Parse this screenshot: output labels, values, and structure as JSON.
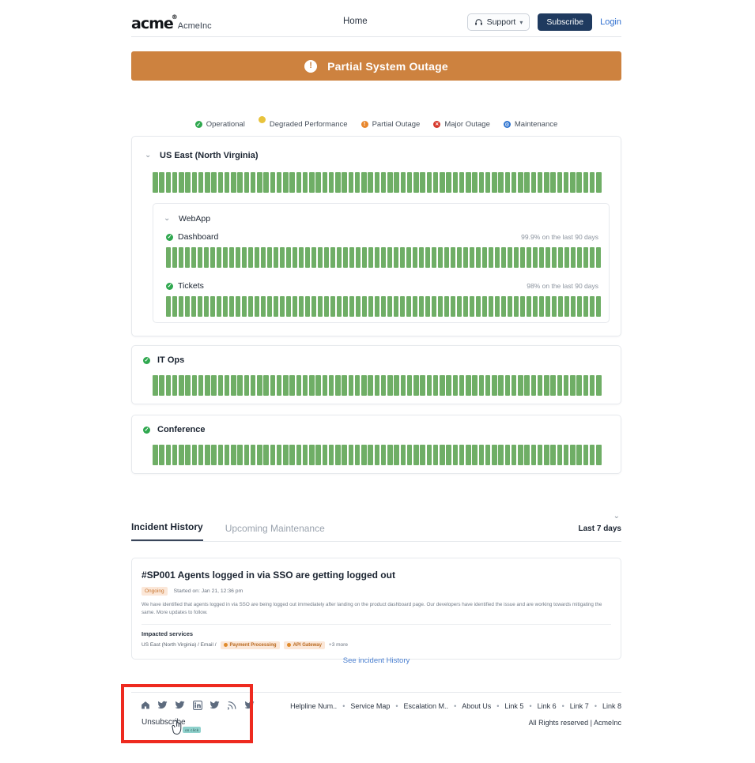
{
  "header": {
    "logo_text": "acme",
    "logo_tm": "®",
    "brand_name": "AcmeInc",
    "nav_home": "Home",
    "support_label": "Support",
    "support_icon": "headset-icon",
    "subscribe_label": "Subscribe",
    "login_label": "Login",
    "subscribe_color": "#1f3a5f"
  },
  "banner": {
    "text": "Partial System Outage",
    "icon": "exclamation-circle-icon",
    "color": "#cd823f"
  },
  "legend": [
    {
      "label": "Operational",
      "color": "#2fa84f",
      "icon": "check-circle-icon"
    },
    {
      "label": "Degraded Performance",
      "color": "#e8c33c",
      "icon": "minus-circle-icon"
    },
    {
      "label": "Partial Outage",
      "color": "#e8862c",
      "icon": "exclamation-circle-icon"
    },
    {
      "label": "Major Outage",
      "color": "#d6382b",
      "icon": "x-circle-icon"
    },
    {
      "label": "Maintenance",
      "color": "#2f74d0",
      "icon": "wrench-circle-icon"
    }
  ],
  "groups": [
    {
      "name": "US East (North Virginia)",
      "collapsible": true,
      "bar_count": 69,
      "bar_color": "#6fae66",
      "subgroup": {
        "name": "WebApp",
        "collapsible": true,
        "services": [
          {
            "name": "Dashboard",
            "status_icon": "check-circle-icon",
            "uptime": "99.9% on the last 90 days",
            "bar_count": 69
          },
          {
            "name": "Tickets",
            "status_icon": "check-circle-icon",
            "uptime": "98% on the last 90 days",
            "bar_count": 69
          }
        ]
      }
    },
    {
      "name": "IT Ops",
      "status_icon": "check-circle-icon",
      "bar_count": 69,
      "bar_color": "#6fae66"
    },
    {
      "name": "Conference",
      "status_icon": "check-circle-icon",
      "bar_count": 69,
      "bar_color": "#6fae66"
    }
  ],
  "tabs": {
    "items": [
      {
        "label": "Incident History",
        "active": true
      },
      {
        "label": "Upcoming Maintenance",
        "active": false
      }
    ],
    "range_label": "Last 7 days",
    "collapse_icon": "chevron-down-icon"
  },
  "incident": {
    "title": "#SP001 Agents logged in via SSO are getting logged out",
    "status_badge": "Ongoing",
    "started": "Started on: Jan 21, 12:36 pm",
    "body": "We have identified that agents logged in via SSO are being logged out immediately after landing on the product dashboard page. Our developers have identified the issue and are working towards mitigating the same. More updates to follow.",
    "impacted_heading": "Impacted services",
    "impacted_path": "US East (North Virginia) / Email /",
    "impacted_pills": [
      "Payment Processing",
      "API Gateway"
    ],
    "impacted_more": "+3 more"
  },
  "see_history_link": "See incident  History",
  "footer": {
    "social_icons": [
      "home-icon",
      "twitter-icon",
      "twitter-icon",
      "linkedin-icon",
      "twitter-icon",
      "rss-icon",
      "twitter-icon"
    ],
    "unsubscribe_label": "Unsubscribe",
    "links": [
      "Helpline Num..",
      "Service Map",
      "Escalation M..",
      "About Us",
      "Link 5",
      "Link 6",
      "Link 7",
      "Link 8"
    ],
    "separator": "•",
    "rights": "All Rights reserved | AcmeInc"
  },
  "annotation": {
    "highlight_color": "#ee2a1f",
    "tooltip_text": "on click",
    "cursor_icon": "pointer-cursor-icon"
  }
}
